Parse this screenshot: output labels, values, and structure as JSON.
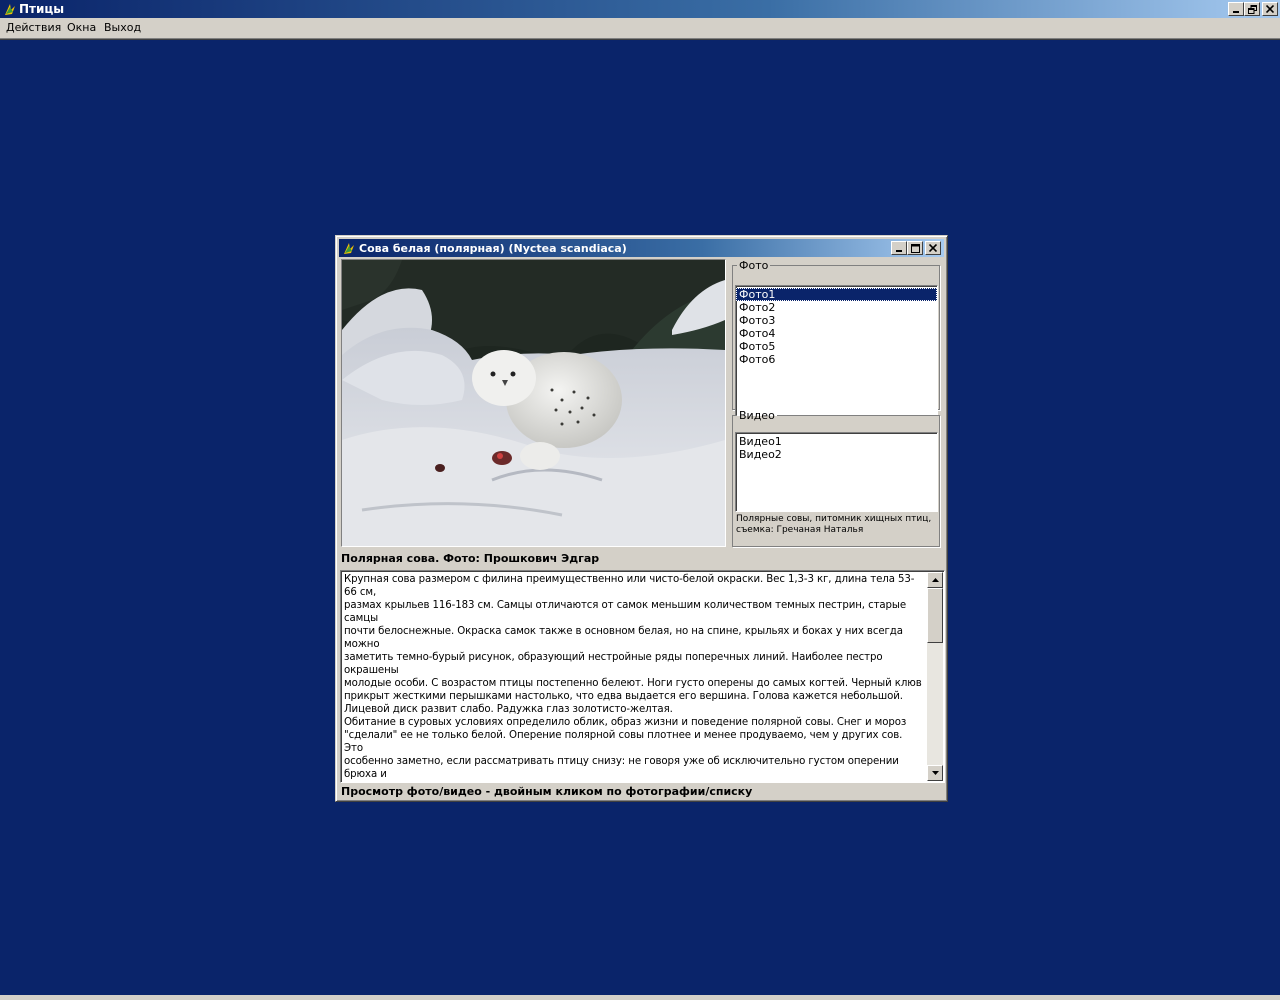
{
  "app": {
    "title": "Птицы",
    "menu": [
      "Действия",
      "Окна",
      "Выход"
    ],
    "caption_buttons": [
      "minimize-icon",
      "restore-icon",
      "close-icon"
    ]
  },
  "child_window": {
    "title": "Сова белая (полярная) (Nyctea scandiaca)",
    "photo_group": {
      "legend": "Фото",
      "items": [
        "Фото1",
        "Фото2",
        "Фото3",
        "Фото4",
        "Фото5",
        "Фото6"
      ],
      "selected": "Фото1"
    },
    "video_group": {
      "legend": "Видео",
      "items": [
        "Видео1",
        "Видео2"
      ],
      "caption": "Полярные совы, питомник хищных птиц, съемка: Гречаная Наталья"
    },
    "photo_caption": "Полярная сова. Фото: Прошкович Эдгар",
    "description": "Крупная сова размером с филина преимущественно или чисто-белой окраски. Вес 1,3-3 кг, длина тела 53-66 см,\nразмах крыльев 116-183 см. Самцы отличаются от самок меньшим количеством темных пестрин, старые самцы\nпочти белоснежные. Окраска самок также в основном белая, но на спине, крыльях и боках у них всегда можно\nзаметить темно-бурый рисунок, образующий нестройные ряды поперечных линий. Наиболее пестро окрашены\nмолодые особи. С возрастом птицы постепенно белеют. Ноги густо оперены до самых когтей. Черный клюв\nприкрыт жесткими перышками настолько, что едва выдается его вершина. Голова кажется небольшой.\nЛицевой диск развит слабо. Радужка глаз золотисто-желтая.\nОбитание в суровых условиях определило облик, образ жизни и поведение полярной совы. Снег и мороз\n\"сделали\" ее не только белой. Оперение полярной совы плотнее и менее продуваемо, чем у других сов. Это\nособенно заметно, если рассматривать птицу снизу: не говоря уже об исключительно густом оперении брюха и\nлап, у нее отлично развиты даже перья подхвостья. И так как длина подхвостья нередко почти равна длине\nхвоста, то кажется, что сидящая на снегу сова опирается на мощную перьевую подушку.\nБрачная песня самца - низкие и глухие, далеко слышные лающие крики, повторяемые несколько раз подряд:\n\"хоу, хоу...\" или \"хув, хув...\". Голос самки - еще более низкое и глухое \"хуу\". При беспокойстве у гнезда самец\nиздает короткие глухие крики \"ххав\", \"уух\", \"ха-ха-ха\", самка - \"хек-хек-хек\" или короткий каркающий крик.\nМолодые, выпрашивающие корм, громко сипловато свистят.",
    "hint": "Просмотр фото/видео - двойным кликом по фотографии/списку"
  },
  "colors": {
    "desktop": "#0a246a",
    "title_start": "#0a246a",
    "title_end": "#a6caf0",
    "face": "#d4d0c8",
    "selection": "#0a246a"
  }
}
